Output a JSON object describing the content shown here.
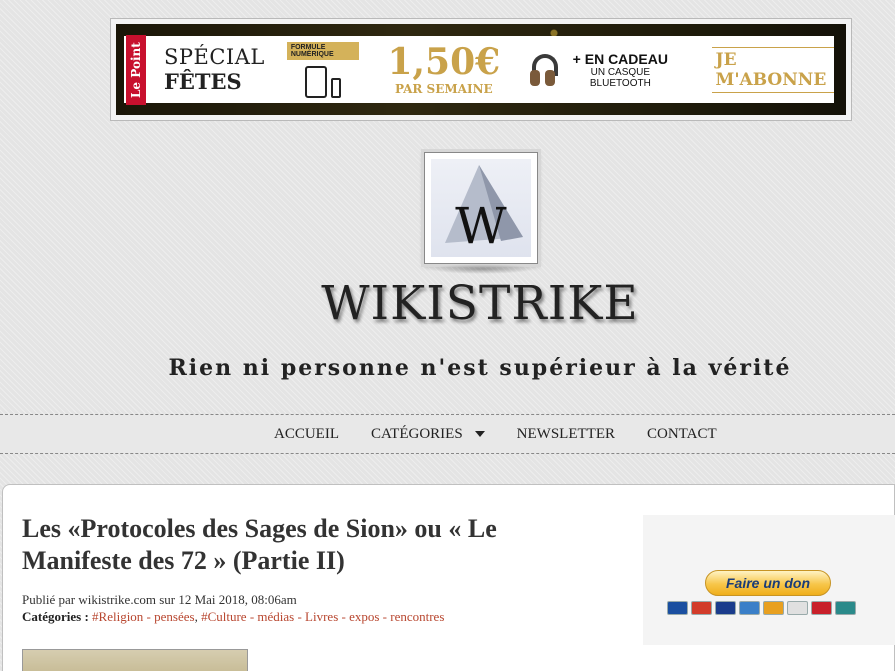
{
  "ad": {
    "brand": "Le Point",
    "special_line1": "SPÉCIAL",
    "special_line2": "FÊTES",
    "formule_tag": "FORMULE NUMÉRIQUE",
    "price": "1,50€",
    "per": "PAR SEMAINE",
    "gift_line1": "+ EN CADEAU",
    "gift_line2": "UN CASQUE BLUETOOTH",
    "cta": "JE M'ABONNE",
    "icons": [
      "tablet-icon",
      "phone-icon",
      "headphones-icon"
    ]
  },
  "site": {
    "logo_letter": "W",
    "title": "WIKISTRIKE",
    "tagline": "Rien ni personne n'est supérieur à la vérité"
  },
  "nav": {
    "items": [
      {
        "label": "ACCUEIL"
      },
      {
        "label": "CATÉGORIES",
        "has_dropdown": true
      },
      {
        "label": "NEWSLETTER"
      },
      {
        "label": "CONTACT"
      }
    ]
  },
  "post": {
    "title": "Les «Protocoles des Sages de Sion» ou « Le Manifeste des 72 » (Partie II)",
    "meta": "Publié par wikistrike.com sur 12 Mai 2018, 08:06am",
    "categories_label": "Catégories :",
    "categories": [
      "#Religion - pensées",
      "#Culture - médias - Livres - expos - rencontres"
    ],
    "categories_sep": ", "
  },
  "sidebar": {
    "donate_label": "Faire un don",
    "cards": [
      {
        "name": "maestro",
        "color": "#1a4fa0"
      },
      {
        "name": "mastercard",
        "color": "#d23c2a"
      },
      {
        "name": "visa",
        "color": "#1a3c8c"
      },
      {
        "name": "amex",
        "color": "#3a7fc8"
      },
      {
        "name": "discover",
        "color": "#e8a020"
      },
      {
        "name": "cofinoga",
        "color": "#e0e0e0"
      },
      {
        "name": "aurore",
        "color": "#c8202a"
      },
      {
        "name": "cb",
        "color": "#2a8a8a"
      }
    ]
  }
}
